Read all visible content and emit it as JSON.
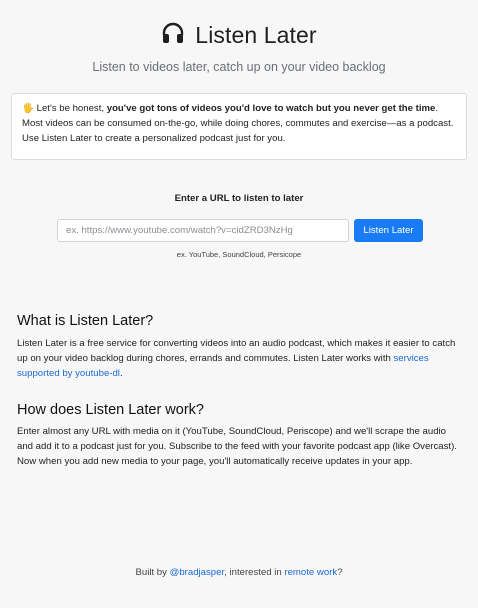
{
  "header": {
    "title": "Listen Later",
    "subtitle": "Listen to videos later, catch up on your video backlog",
    "icon": "headphones-icon"
  },
  "intro": {
    "emoji": "🖐",
    "lead": "Let's be honest, ",
    "bold": "you've got tons of videos you'd love to watch but you never get the time",
    "rest": ". Most videos can be consumed on-the-go, while doing chores, commutes and exercise—as a podcast. Use Listen Later to create a personalized podcast just for you."
  },
  "form": {
    "label": "Enter a URL to listen to later",
    "placeholder": "ex. https://www.youtube.com/watch?v=cidZRD3NzHg",
    "value": "",
    "button_label": "Listen Later",
    "hint": "ex. YouTube, SoundCloud, Persicope"
  },
  "what": {
    "heading": "What is Listen Later?",
    "body": "Listen Later is a free service for converting videos into an audio podcast, which makes it easier to catch up on your video backlog during chores, errands and commutes. Listen Later works with ",
    "link": "services supported by youtube-dl",
    "end": "."
  },
  "how": {
    "heading": "How does Listen Later work?",
    "body": "Enter almost any URL with media on it (YouTube, SoundCloud, Periscope) and we'll scrape the audio and add it to a podcast just for you. Subscribe to the feed with your favorite podcast app (like Overcast). Now when you add new media to your page, you'll automatically receive updates in your app."
  },
  "footer": {
    "prefix": "Built by ",
    "author_link": "@bradjasper",
    "middle": ", interested in ",
    "remote_link": "remote work",
    "suffix": "?"
  },
  "colors": {
    "accent": "#1a7cf5",
    "link": "#1a6ad6",
    "background": "#f7f7f8"
  }
}
